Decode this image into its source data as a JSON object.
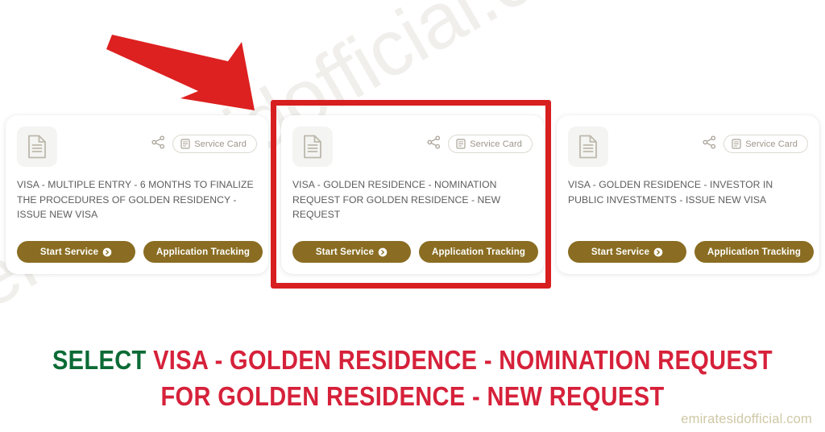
{
  "page": {
    "background_color": "#ffffff",
    "watermark_text": "emiratesidofficial.com",
    "site_credit": "emiratesidofficial.com"
  },
  "theme": {
    "button_gold": "#8a6d22",
    "annotation_red": "#d81f1f",
    "caption_red": "#d6213a",
    "caption_green": "#0b6b35",
    "card_text_gray": "#5d5d5d",
    "pill_text": "#9d968a",
    "credit_color": "#cfc8a6"
  },
  "cards": [
    {
      "doc_icon": "document-icon",
      "share_icon": "share-icon",
      "service_card_pill": {
        "icon": "service-card-icon",
        "label": "Service Card"
      },
      "title": "VISA - MULTIPLE ENTRY - 6 MONTHS TO FINALIZE THE PROCEDURES OF GOLDEN RESIDENCY - ISSUE NEW VISA",
      "start_label": "Start Service",
      "start_icon": "arrow-right-circle-icon",
      "track_label": "Application Tracking",
      "highlighted": false
    },
    {
      "doc_icon": "document-icon",
      "share_icon": "share-icon",
      "service_card_pill": {
        "icon": "service-card-icon",
        "label": "Service Card"
      },
      "title": "VISA - GOLDEN RESIDENCE - NOMINATION REQUEST FOR GOLDEN RESIDENCE - NEW REQUEST",
      "start_label": "Start Service",
      "start_icon": "arrow-right-circle-icon",
      "track_label": "Application Tracking",
      "highlighted": true
    },
    {
      "doc_icon": "document-icon",
      "share_icon": "share-icon",
      "service_card_pill": {
        "icon": "service-card-icon",
        "label": "Service Card"
      },
      "title": "VISA - GOLDEN RESIDENCE - INVESTOR IN PUBLIC INVESTMENTS - ISSUE NEW VISA",
      "start_label": "Start Service",
      "start_icon": "arrow-right-circle-icon",
      "track_label": "Application Tracking",
      "highlighted": false
    }
  ],
  "annotations": {
    "arrow": "red-arrow-pointing-to-second-card",
    "highlight_box": "red-rectangle-around-second-card"
  },
  "caption": {
    "line1_prefix": "SELECT",
    "line1_rest": "VISA - GOLDEN RESIDENCE - NOMINATION REQUEST",
    "line2": "FOR GOLDEN RESIDENCE - NEW REQUEST"
  }
}
